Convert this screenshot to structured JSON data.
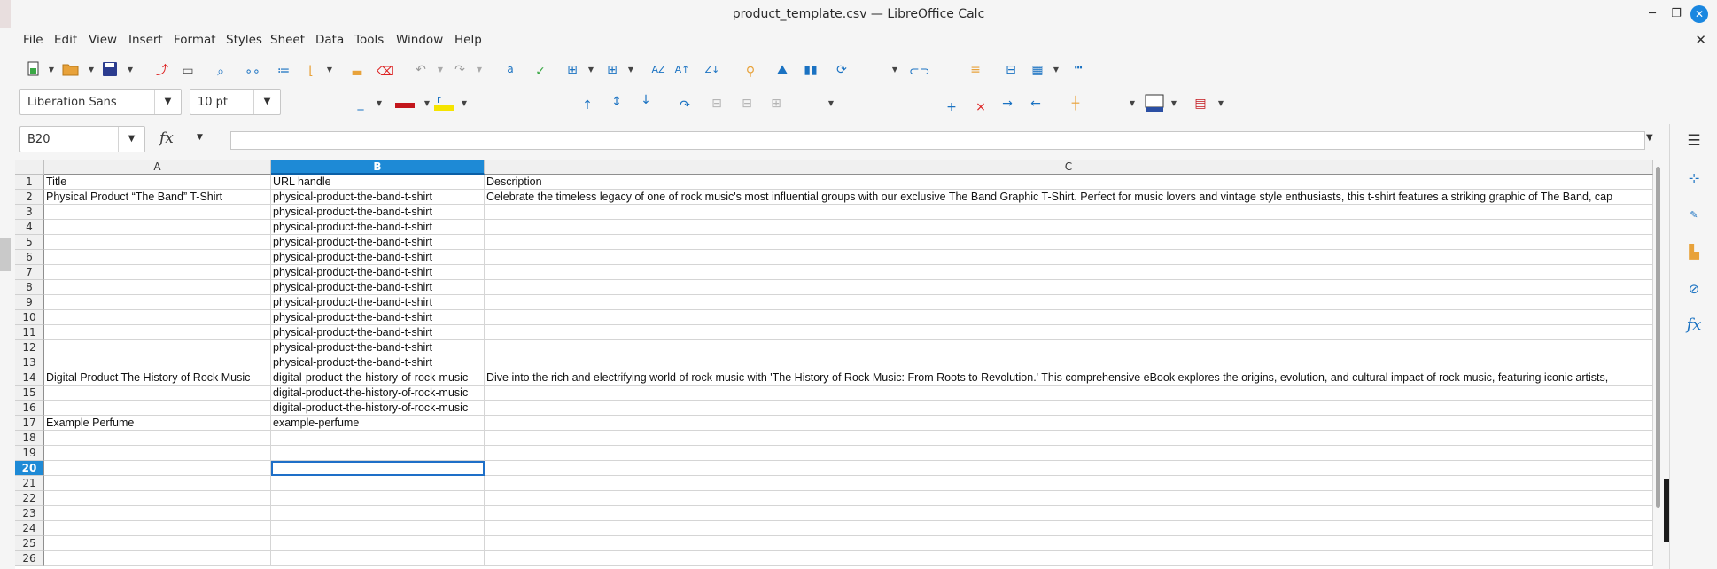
{
  "window": {
    "title": "product_template.csv — LibreOffice Calc",
    "controls": {
      "minimize": "─",
      "maximize": "❐",
      "close": "✕"
    }
  },
  "menu": {
    "items": [
      "File",
      "Edit",
      "View",
      "Insert",
      "Format",
      "Styles",
      "Sheet",
      "Data",
      "Tools",
      "Window",
      "Help"
    ],
    "doc_close": "✕"
  },
  "toolbar": {
    "font_name": "Liberation Sans",
    "font_size": "10 pt",
    "dropdown_glyph": "▼"
  },
  "formula_bar": {
    "name_box": "B20",
    "fx": "fx",
    "content": ""
  },
  "sheet": {
    "columns": [
      "A",
      "B",
      "C"
    ],
    "selected_column": "B",
    "selected_row": "20",
    "active_cell": "B20",
    "rows": [
      {
        "n": "1",
        "a": "Title",
        "b": "URL handle",
        "c": "Description"
      },
      {
        "n": "2",
        "a": "Physical Product “The Band” T-Shirt",
        "b": "physical-product-the-band-t-shirt",
        "c": "Celebrate the timeless legacy of one of rock music's most influential groups with our exclusive The Band Graphic T-Shirt. Perfect for music lovers and vintage style enthusiasts, this t-shirt features a striking graphic of The Band, cap"
      },
      {
        "n": "3",
        "a": "",
        "b": "physical-product-the-band-t-shirt",
        "c": ""
      },
      {
        "n": "4",
        "a": "",
        "b": "physical-product-the-band-t-shirt",
        "c": ""
      },
      {
        "n": "5",
        "a": "",
        "b": "physical-product-the-band-t-shirt",
        "c": ""
      },
      {
        "n": "6",
        "a": "",
        "b": "physical-product-the-band-t-shirt",
        "c": ""
      },
      {
        "n": "7",
        "a": "",
        "b": "physical-product-the-band-t-shirt",
        "c": ""
      },
      {
        "n": "8",
        "a": "",
        "b": "physical-product-the-band-t-shirt",
        "c": ""
      },
      {
        "n": "9",
        "a": "",
        "b": "physical-product-the-band-t-shirt",
        "c": ""
      },
      {
        "n": "10",
        "a": "",
        "b": "physical-product-the-band-t-shirt",
        "c": ""
      },
      {
        "n": "11",
        "a": "",
        "b": "physical-product-the-band-t-shirt",
        "c": ""
      },
      {
        "n": "12",
        "a": "",
        "b": "physical-product-the-band-t-shirt",
        "c": ""
      },
      {
        "n": "13",
        "a": "",
        "b": "physical-product-the-band-t-shirt",
        "c": ""
      },
      {
        "n": "14",
        "a": "Digital Product The History of Rock Music",
        "b": "digital-product-the-history-of-rock-music",
        "c": "Dive into the rich and electrifying world of rock music with 'The History of Rock Music: From Roots to Revolution.' This comprehensive eBook explores the origins, evolution, and cultural impact of rock music, featuring iconic artists,"
      },
      {
        "n": "15",
        "a": "",
        "b": "digital-product-the-history-of-rock-music",
        "c": ""
      },
      {
        "n": "16",
        "a": "",
        "b": "digital-product-the-history-of-rock-music",
        "c": ""
      },
      {
        "n": "17",
        "a": "Example Perfume",
        "b": "example-perfume",
        "c": ""
      },
      {
        "n": "18",
        "a": "",
        "b": "",
        "c": ""
      },
      {
        "n": "19",
        "a": "",
        "b": "",
        "c": ""
      },
      {
        "n": "20",
        "a": "",
        "b": "",
        "c": ""
      },
      {
        "n": "21",
        "a": "",
        "b": "",
        "c": ""
      },
      {
        "n": "22",
        "a": "",
        "b": "",
        "c": ""
      },
      {
        "n": "23",
        "a": "",
        "b": "",
        "c": ""
      },
      {
        "n": "24",
        "a": "",
        "b": "",
        "c": ""
      },
      {
        "n": "25",
        "a": "",
        "b": "",
        "c": ""
      },
      {
        "n": "26",
        "a": "",
        "b": "",
        "c": ""
      }
    ]
  },
  "sidebar": {
    "icons": [
      "hamburger-menu-icon",
      "properties-icon",
      "styles-icon",
      "gallery-icon",
      "navigator-icon",
      "functions-icon"
    ],
    "functions_label": "fx"
  },
  "colors": {
    "accent": "#1e8ad6",
    "close_button": "#1a87e0"
  }
}
